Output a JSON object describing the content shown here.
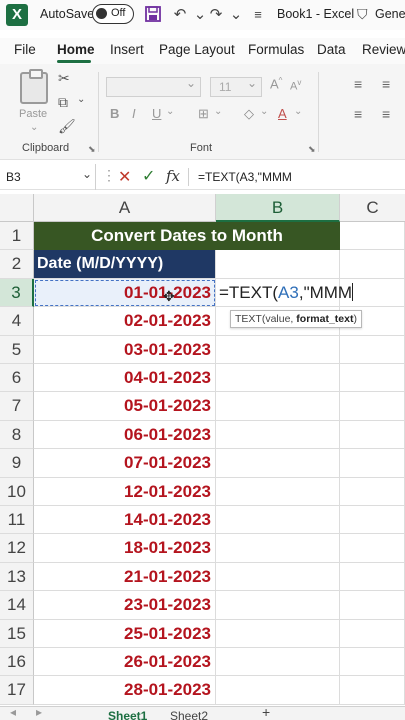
{
  "titlebar": {
    "autosave_label": "AutoSave",
    "autosave_state": "Off",
    "title": "Book1 - Excel",
    "account": "Gener"
  },
  "tabs": [
    "File",
    "Home",
    "Insert",
    "Page Layout",
    "Formulas",
    "Data",
    "Review"
  ],
  "ribbon": {
    "paste_label": "Paste",
    "clipboard_label": "Clipboard",
    "font_label": "Font",
    "font_size": "11"
  },
  "formula_bar": {
    "name_box": "B3",
    "formula": "=TEXT(A3,\"MMM"
  },
  "columns": [
    "A",
    "B",
    "C"
  ],
  "rows": [
    "1",
    "2",
    "3",
    "4",
    "5",
    "6",
    "7",
    "8",
    "9",
    "10",
    "11",
    "12",
    "13",
    "14",
    "15",
    "16",
    "17"
  ],
  "sheet": {
    "title": "Convert Dates to Month",
    "header": "Date (M/D/YYYY)",
    "dates": [
      "01-01-2023",
      "02-01-2023",
      "03-01-2023",
      "04-01-2023",
      "05-01-2023",
      "06-01-2023",
      "07-01-2023",
      "12-01-2023",
      "14-01-2023",
      "18-01-2023",
      "21-01-2023",
      "23-01-2023",
      "25-01-2023",
      "26-01-2023",
      "28-01-2023"
    ],
    "edit_prefix": "=TEXT(",
    "edit_ref": "A3",
    "edit_suffix": ",\"MMM",
    "tooltip_fn": "TEXT(value, ",
    "tooltip_arg": "format_text",
    "tooltip_end": ")"
  },
  "sheet_tabs": [
    "Sheet1",
    "Sheet2"
  ],
  "colors": {
    "title_fill": "#375623",
    "header_fill": "#1f3864",
    "date_text": "#b4141e",
    "accent": "#1d6f42"
  }
}
